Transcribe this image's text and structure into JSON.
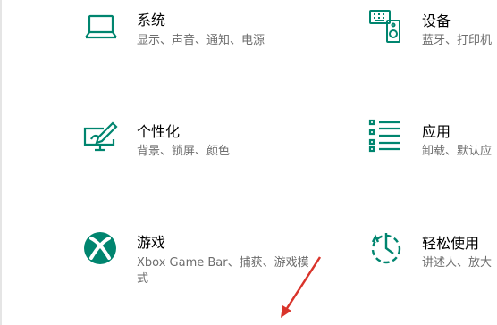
{
  "accent_color": "#00856f",
  "arrow_color": "#d9342b",
  "settings_tiles": [
    {
      "id": "system",
      "icon": "laptop-icon",
      "title": "系统",
      "desc": "显示、声音、通知、电源"
    },
    {
      "id": "devices",
      "icon": "keyboard-speaker-icon",
      "title": "设备",
      "desc": "蓝牙、打印机"
    },
    {
      "id": "personalization",
      "icon": "monitor-pen-icon",
      "title": "个性化",
      "desc": "背景、锁屏、颜色"
    },
    {
      "id": "apps",
      "icon": "list-icon",
      "title": "应用",
      "desc": "卸载、默认应"
    },
    {
      "id": "gaming",
      "icon": "xbox-icon",
      "title": "游戏",
      "desc": "Xbox Game Bar、捕获、游戏模式"
    },
    {
      "id": "ease-of-access",
      "icon": "ease-of-access-icon",
      "title": "轻松使用",
      "desc": "讲述人、放大"
    }
  ]
}
